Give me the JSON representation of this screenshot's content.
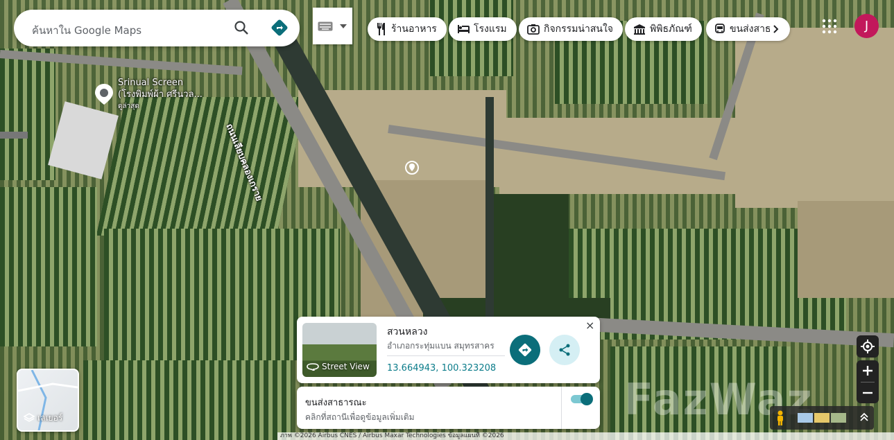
{
  "search": {
    "placeholder": "ค้นหาใน Google Maps"
  },
  "chips": [
    {
      "label": "ร้านอาหาร",
      "icon": "fork-knife-icon"
    },
    {
      "label": "โรงแรม",
      "icon": "bed-icon"
    },
    {
      "label": "กิจกรรมน่าสนใจ",
      "icon": "camera-icon"
    },
    {
      "label": "พิพิธภัณฑ์",
      "icon": "museum-icon"
    },
    {
      "label": "ขนส่งสาธ",
      "icon": "bus-icon"
    }
  ],
  "account": {
    "initial": "J",
    "color": "#c2185b"
  },
  "poi": {
    "name_line1": "Srinual Screen",
    "name_line2": "(โรงพิมพ์ผ้า ศรีนวล...",
    "sub": "ดูล่าสุด"
  },
  "road_label": "ถนนเลียบคลองเกราย",
  "place_card": {
    "title": "สวนหลวง",
    "address": "อำเภอกระทุ่มแบน สมุทรสาคร",
    "coords": "13.664943, 100.323208",
    "street_view_label": "Street View",
    "close": "×"
  },
  "transit_card": {
    "title": "ขนส่งสาธารณะ",
    "subtitle": "คลิกที่สถานีเพื่อดูข้อมูลเพิ่มเติม",
    "enabled": true
  },
  "layers": {
    "label": "เลเยอร์"
  },
  "watermark": "FazWaz",
  "attribution": "ภาพ ©2026 Airbus CNES / Airbus Maxar Technologies ข้อมูลแผนที่ ©2026",
  "colors": {
    "accent": "#0b6e7a",
    "link": "#0b7c8a"
  }
}
